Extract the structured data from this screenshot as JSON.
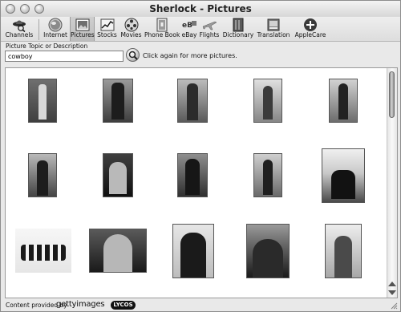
{
  "window": {
    "title": "Sherlock - Pictures"
  },
  "toolbar": {
    "channels_label": "Channels",
    "items": [
      {
        "label": "Internet",
        "icon": "internet-icon"
      },
      {
        "label": "Pictures",
        "icon": "pictures-icon",
        "selected": true
      },
      {
        "label": "Stocks",
        "icon": "stocks-icon"
      },
      {
        "label": "Movies",
        "icon": "movies-icon"
      },
      {
        "label": "Phone Book",
        "icon": "phone-book-icon"
      },
      {
        "label": "eBay",
        "icon": "ebay-icon"
      },
      {
        "label": "Flights",
        "icon": "flights-icon"
      },
      {
        "label": "Dictionary",
        "icon": "dictionary-icon"
      },
      {
        "label": "Translation",
        "icon": "translation-icon"
      },
      {
        "label": "AppleCare",
        "icon": "applecare-icon"
      }
    ]
  },
  "search": {
    "label": "Picture Topic or Description",
    "value": "cowboy",
    "hint": "Click again for more pictures."
  },
  "results": {
    "photos": [
      {
        "name": "cowboy-photo-1"
      },
      {
        "name": "cowboy-photo-2"
      },
      {
        "name": "cowboy-photo-3"
      },
      {
        "name": "cowboy-photo-4"
      },
      {
        "name": "cowboy-photo-5"
      },
      {
        "name": "cowboy-photo-6"
      },
      {
        "name": "cowboy-photo-7"
      },
      {
        "name": "cowboy-photo-8"
      },
      {
        "name": "cowboy-photo-9"
      },
      {
        "name": "cowboy-photo-10"
      },
      {
        "name": "cowboy-photo-11"
      },
      {
        "name": "cowboy-photo-12"
      },
      {
        "name": "cowboy-photo-13"
      },
      {
        "name": "cowboy-photo-14"
      },
      {
        "name": "cowboy-photo-15"
      }
    ]
  },
  "footer": {
    "content_label": "Content provided by",
    "provider1": "gettyimages",
    "provider2": "LYCOS"
  }
}
